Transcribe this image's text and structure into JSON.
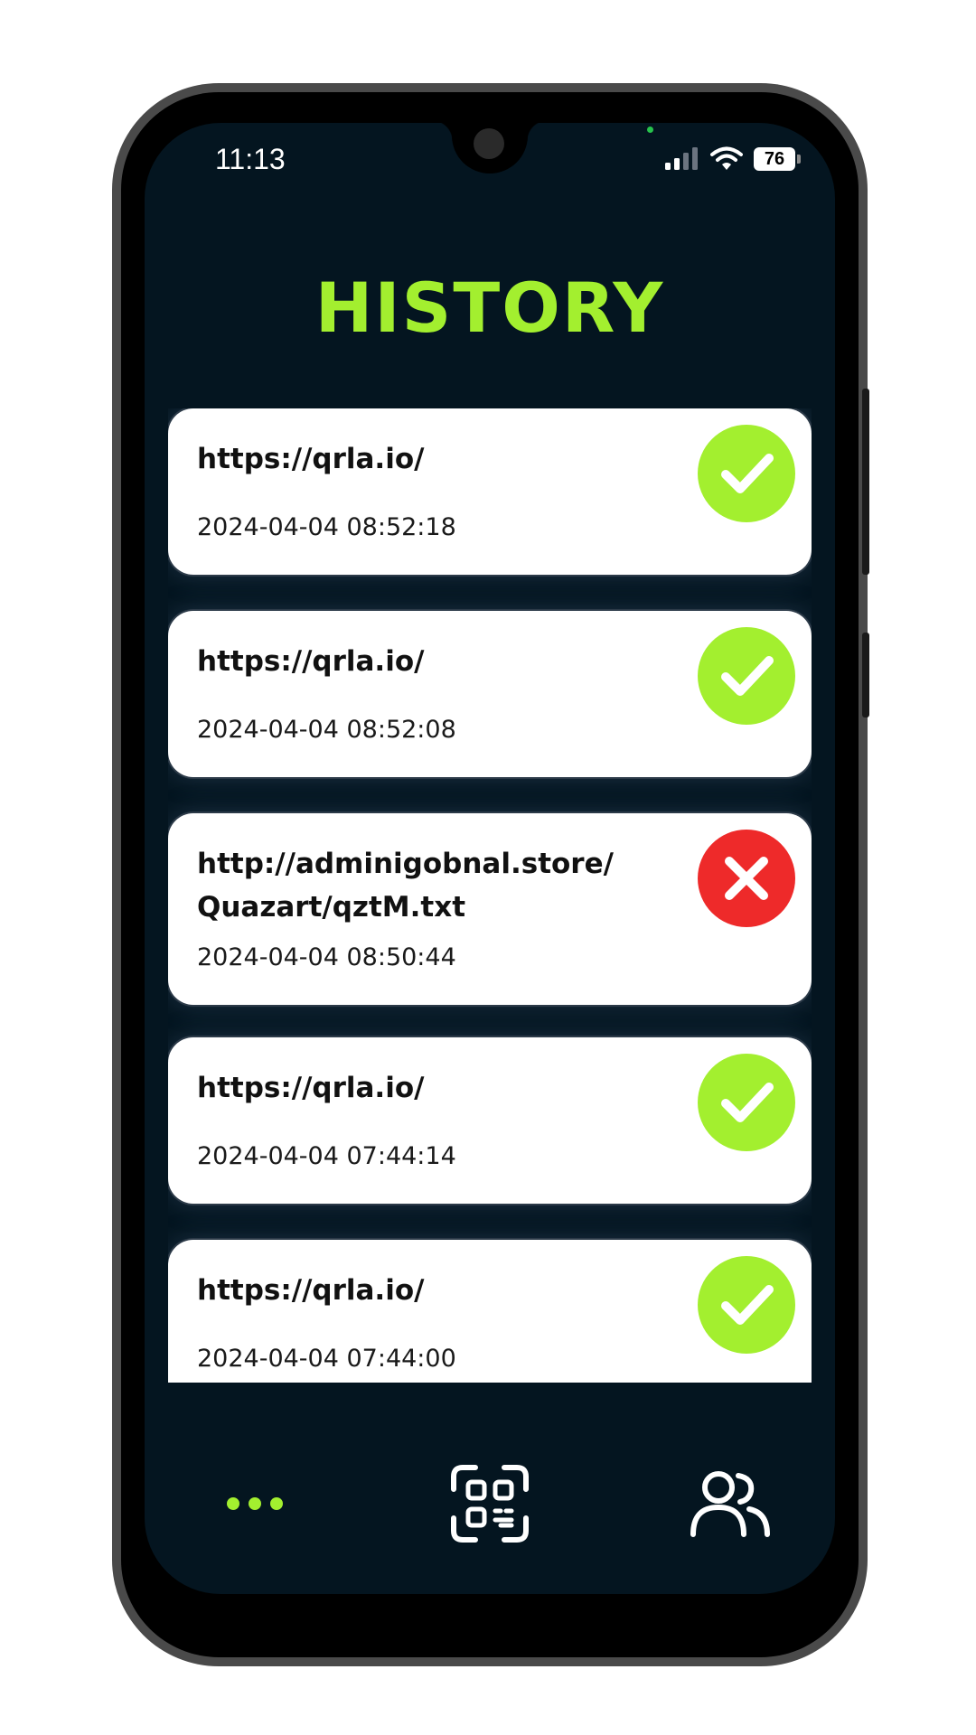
{
  "status_bar": {
    "time": "11:13",
    "battery": "76"
  },
  "header": {
    "title": "HISTORY"
  },
  "history": [
    {
      "url": "https://qrla.io/",
      "timestamp": "2024-04-04 08:52:18",
      "status": "safe",
      "status_icon": "check-icon"
    },
    {
      "url": "https://qrla.io/",
      "timestamp": "2024-04-04 08:52:08",
      "status": "safe",
      "status_icon": "check-icon"
    },
    {
      "url": "http://adminigobnal.store/\nQuazart/qztM.txt",
      "timestamp": "2024-04-04 08:50:44",
      "status": "unsafe",
      "status_icon": "cross-icon"
    },
    {
      "url": "https://qrla.io/",
      "timestamp": "2024-04-04 07:44:14",
      "status": "safe",
      "status_icon": "check-icon"
    },
    {
      "url": "https://qrla.io/",
      "timestamp": "2024-04-04 07:44:00",
      "status": "safe",
      "status_icon": "check-icon"
    }
  ],
  "bottom_nav": {
    "items": [
      {
        "icon": "more-dots-icon",
        "active": true
      },
      {
        "icon": "qr-scan-icon",
        "active": false
      },
      {
        "icon": "users-icon",
        "active": false
      }
    ]
  },
  "colors": {
    "accent": "#a3ef2f",
    "danger": "#ee2a2a",
    "background": "#041520",
    "card": "#ffffff"
  }
}
